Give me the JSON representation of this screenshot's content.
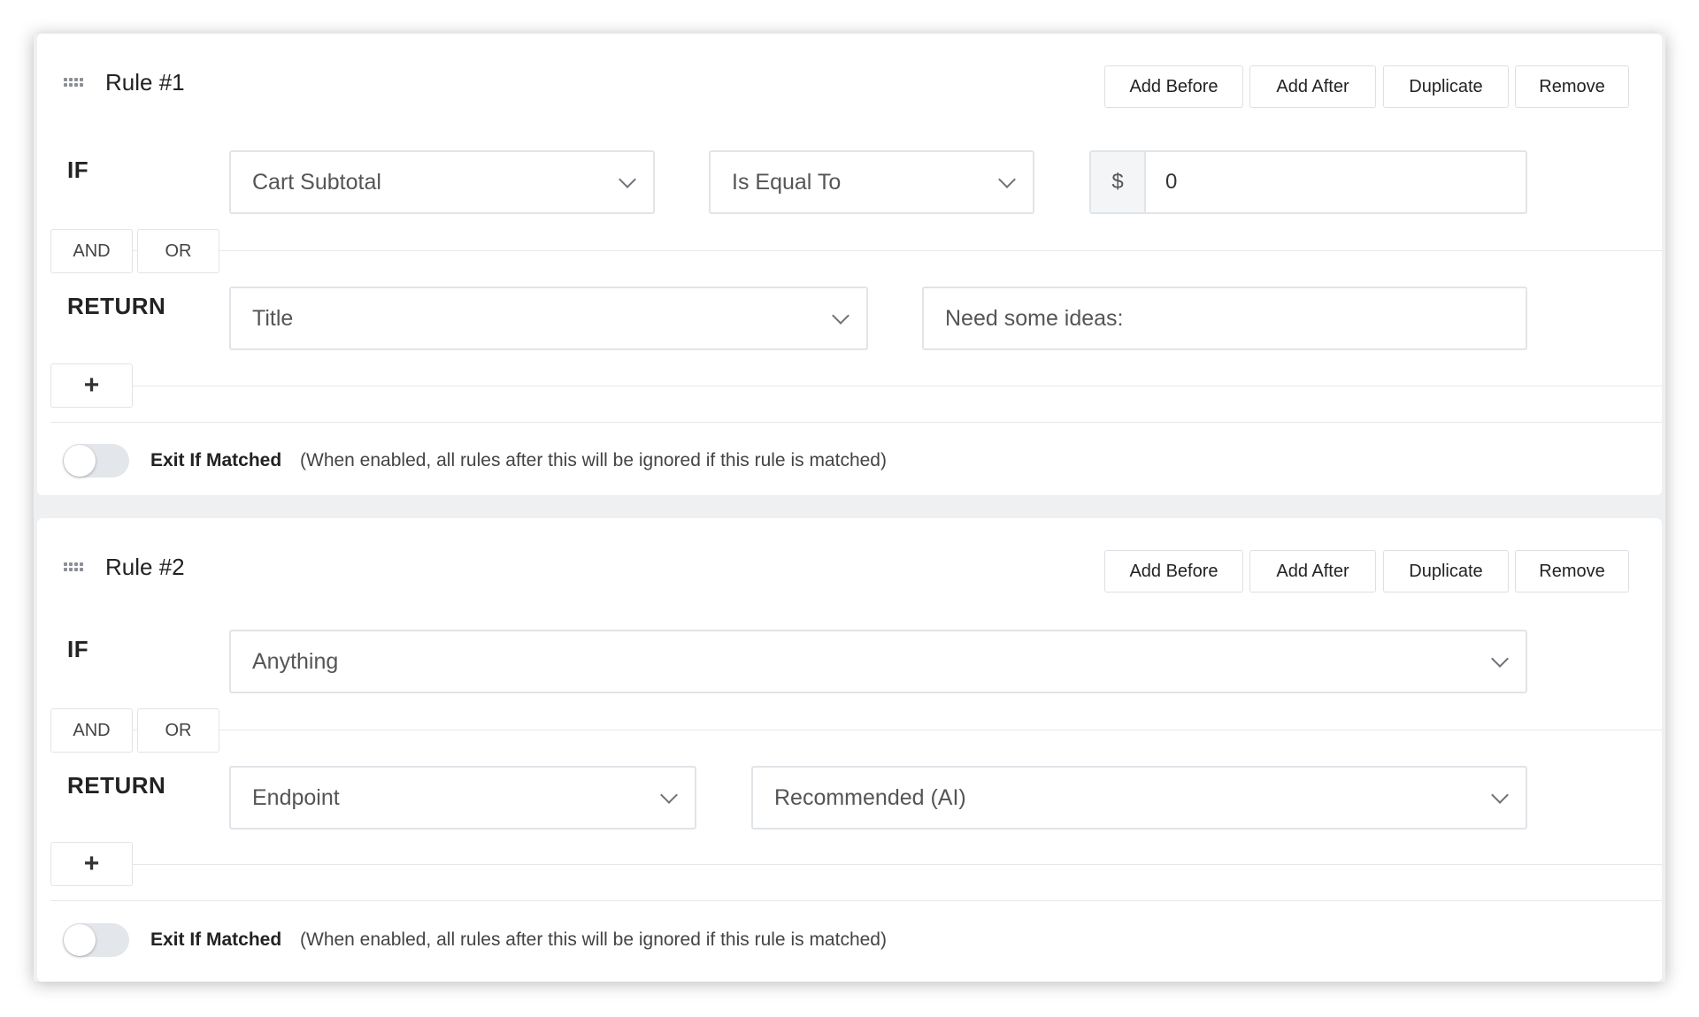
{
  "buttons": {
    "add_before": "Add Before",
    "add_after": "Add After",
    "duplicate": "Duplicate",
    "remove": "Remove",
    "and": "AND",
    "or": "OR",
    "add_return": "+"
  },
  "keywords": {
    "if": "IF",
    "return": "RETURN"
  },
  "exit": {
    "label": "Exit If Matched",
    "hint": "(When enabled, all rules after this will be ignored if this rule is matched)"
  },
  "rules": [
    {
      "title": "Rule #1",
      "condition": {
        "field": "Cart Subtotal",
        "operator": "Is Equal To",
        "currency_symbol": "$",
        "value": "0"
      },
      "return": {
        "type": "Title",
        "text_value": "Need some ideas:"
      },
      "exit_if_matched": false
    },
    {
      "title": "Rule #2",
      "condition": {
        "field": "Anything"
      },
      "return": {
        "type": "Endpoint",
        "option": "Recommended (AI)"
      },
      "exit_if_matched": false
    }
  ]
}
